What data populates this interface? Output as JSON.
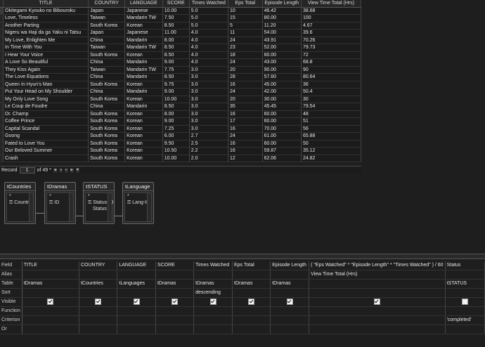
{
  "grid": {
    "columns": [
      "TITLE",
      "COUNTRY",
      "LANGUAGE",
      "SCORE",
      "Times Watched",
      "Eps Total",
      "Episode Length",
      "View Time Total (Hrs)"
    ],
    "rows": [
      [
        "Okitegami Kyouko no Bibouroku",
        "Japan",
        "Japanese",
        "10.00",
        "5.0",
        "10",
        "46.42",
        "38.68"
      ],
      [
        "Love, Timeless",
        "Taiwan",
        "Mandarin TW",
        "7.50",
        "5.0",
        "15",
        "80.00",
        "100"
      ],
      [
        "Another Parting",
        "South Korea",
        "Korean",
        "8.50",
        "5.0",
        "5",
        "11.20",
        "4.67"
      ],
      [
        "Nigeru wa Haji da ga Yaku ni Tatsu",
        "Japan",
        "Japanese",
        "11.00",
        "4.0",
        "11",
        "54.00",
        "39.6"
      ],
      [
        "My Love, Enlighten Me",
        "China",
        "Mandarin",
        "8.00",
        "4.0",
        "24",
        "43.91",
        "70.26"
      ],
      [
        "In Time With You",
        "Taiwan",
        "Mandarin TW",
        "8.50",
        "4.0",
        "23",
        "52.00",
        "79.73"
      ],
      [
        "I Hear Your Voice",
        "South Korea",
        "Korean",
        "8.50",
        "4.0",
        "18",
        "60.00",
        "72"
      ],
      [
        "A Love So Beautiful",
        "China",
        "Mandarin",
        "9.00",
        "4.0",
        "24",
        "43.00",
        "68.8"
      ],
      [
        "They Kiss Again",
        "Taiwan",
        "Mandarin TW",
        "7.75",
        "3.0",
        "20",
        "90.00",
        "90"
      ],
      [
        "The Love Equations",
        "China",
        "Mandarin",
        "8.50",
        "3.0",
        "28",
        "57.60",
        "80.64"
      ],
      [
        "Queen In Hyun's Man",
        "South Korea",
        "Korean",
        "9.75",
        "3.0",
        "16",
        "45.00",
        "36"
      ],
      [
        "Put Your Head on My Shoulder",
        "China",
        "Mandarin",
        "9.00",
        "3.0",
        "24",
        "42.00",
        "50.4"
      ],
      [
        "My Only Love Song",
        "South Korea",
        "Korean",
        "10.00",
        "3.0",
        "20",
        "30.00",
        "30"
      ],
      [
        "Le Coup de Foudre",
        "China",
        "Mandarin",
        "8.50",
        "3.0",
        "35",
        "45.45",
        "79.54"
      ],
      [
        "Dr. Champ",
        "South Korea",
        "Korean",
        "8.00",
        "3.0",
        "16",
        "60.00",
        "48"
      ],
      [
        "Coffee Prince",
        "South Korea",
        "Korean",
        "9.00",
        "3.0",
        "17",
        "60.00",
        "51"
      ],
      [
        "Capital Scandal",
        "South Korea",
        "Korean",
        "7.25",
        "3.0",
        "16",
        "70.00",
        "56"
      ],
      [
        "Goong",
        "South Korea",
        "Korean",
        "6.00",
        "2.7",
        "24",
        "61.00",
        "65.88"
      ],
      [
        "Fated to Love You",
        "South Korea",
        "Korean",
        "9.50",
        "2.5",
        "16",
        "60.00",
        "50"
      ],
      [
        "Our Beloved Summer",
        "South Korea",
        "Korean",
        "10.50",
        "2.2",
        "16",
        "59.87",
        "35.12"
      ],
      [
        "Crash",
        "South Korea",
        "Korean",
        "10.00",
        "2.0",
        "12",
        "62.06",
        "24.82"
      ]
    ]
  },
  "nav": {
    "record_label": "Record",
    "current": "1",
    "of_label": "of 49 *"
  },
  "diagram": {
    "tables": [
      {
        "name": "tCountries",
        "field": "Country"
      },
      {
        "name": "tDramas",
        "field": "ID"
      },
      {
        "name": "tSTATUS",
        "field": "Status-ID",
        "field2": "Status"
      },
      {
        "name": "tLanguage",
        "field": "Lang-ID"
      }
    ]
  },
  "design": {
    "row_labels": [
      "Field",
      "Alias",
      "Table",
      "Sort",
      "Visible",
      "Function",
      "Criterion",
      "Or"
    ],
    "columns": [
      {
        "field": "TITLE",
        "alias": "",
        "table": "tDramas",
        "sort": "",
        "visible": true,
        "criterion": ""
      },
      {
        "field": "COUNTRY",
        "alias": "",
        "table": "tCountries",
        "sort": "",
        "visible": true,
        "criterion": ""
      },
      {
        "field": "LANGUAGE",
        "alias": "",
        "table": "tLanguages",
        "sort": "",
        "visible": true,
        "criterion": ""
      },
      {
        "field": "SCORE",
        "alias": "",
        "table": "tDramas",
        "sort": "",
        "visible": true,
        "criterion": ""
      },
      {
        "field": "Times Watched",
        "alias": "",
        "table": "tDramas",
        "sort": "descending",
        "visible": true,
        "criterion": ""
      },
      {
        "field": "Eps Total",
        "alias": "",
        "table": "tDramas",
        "sort": "",
        "visible": true,
        "criterion": ""
      },
      {
        "field": "Episode Length",
        "alias": "",
        "table": "tDramas",
        "sort": "",
        "visible": true,
        "criterion": ""
      },
      {
        "field": "( \"Eps Watched\" * \"Episode Length\" * \"Times Watched\" ) / 60",
        "alias": "View Time Total (Hrs)",
        "table": "",
        "sort": "",
        "visible": true,
        "criterion": ""
      },
      {
        "field": "Status",
        "alias": "",
        "table": "tSTATUS",
        "sort": "",
        "visible": false,
        "criterion": "'completed'"
      }
    ]
  },
  "colors": {
    "background": "#1e1e1e",
    "border": "#444444",
    "text": "#e6e6e6"
  }
}
